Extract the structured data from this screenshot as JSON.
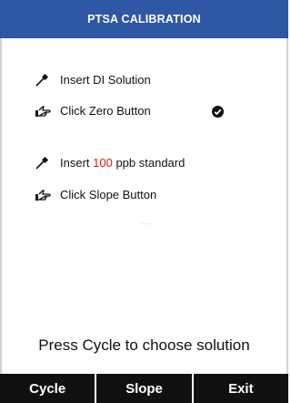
{
  "header": {
    "title": "PTSA CALIBRATION"
  },
  "steps": [
    {
      "icon": "dropper-icon",
      "text": "Insert DI Solution"
    },
    {
      "icon": "pointing-hand-icon",
      "text": "Click Zero Button",
      "done": true
    },
    {
      "icon": "dropper-icon",
      "prefix": "Insert ",
      "value": "100",
      "suffix": " ppb standard"
    },
    {
      "icon": "pointing-hand-icon",
      "text": "Click Slope Button"
    }
  ],
  "status": {
    "icon": "check-circle-icon"
  },
  "prompt": "Press Cycle to choose solution",
  "softkeys": [
    {
      "label": "Cycle"
    },
    {
      "label": "Slope"
    },
    {
      "label": "Exit"
    }
  ],
  "colors": {
    "header_bg": "#2e57a4",
    "accent_value": "#e01a10",
    "softkey_bg": "#111111"
  }
}
